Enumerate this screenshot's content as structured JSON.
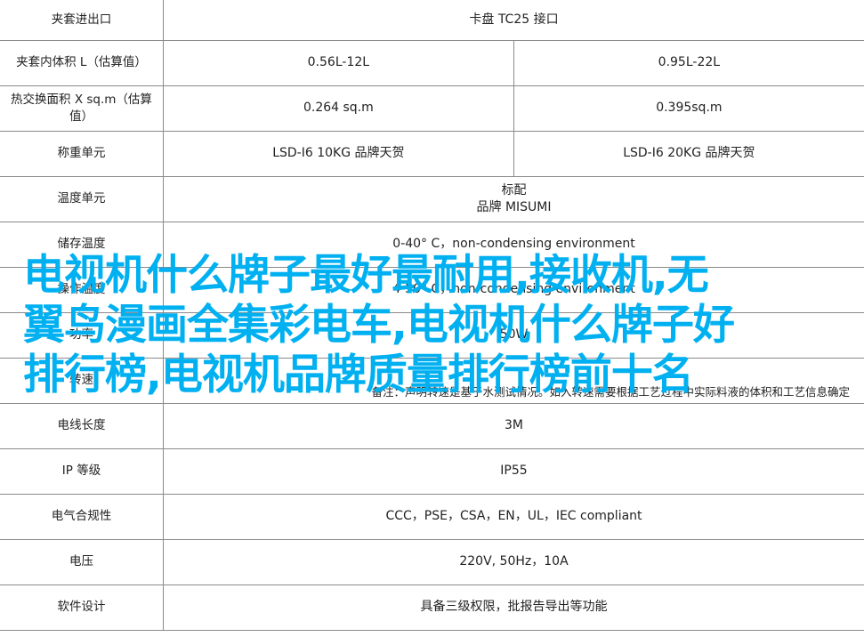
{
  "rows": [
    {
      "label": "夹套进出口",
      "span": false,
      "left": "",
      "right": "卡盘 TC25 接口"
    },
    {
      "label": "夹套内体积 L（估算值）",
      "span": false,
      "left": "0.56L-12L",
      "right": "0.95L-22L"
    },
    {
      "label": "热交换面积 X sq.m（估算值）",
      "span": false,
      "left": "0.264 sq.m",
      "right": "0.395sq.m"
    },
    {
      "label": "称重单元",
      "span": false,
      "left": "LSD-I6 10KG 品牌天贺",
      "right": "LSD-I6 20KG 品牌天贺"
    },
    {
      "label": "温度单元",
      "span": true,
      "line1": "标配",
      "line2": "品牌 MISUMI"
    },
    {
      "label": "储存温度",
      "span": true,
      "line1": "0-40° C，non-condensing environment",
      "line2": ""
    },
    {
      "label": "操作温度",
      "span": true,
      "line1": "4-50° C，non-condensing environment",
      "line2": ""
    },
    {
      "label": "功率",
      "span": true,
      "line1": "50W",
      "line2": ""
    },
    {
      "label": "转速",
      "span": true,
      "line1": "",
      "line2": "备注：声明转速是基于水测试情况。",
      "note": "如入转速需要根据工艺过程中实际料液的体积和工艺信息确定"
    },
    {
      "label": "电线长度",
      "span": true,
      "line1": "3M",
      "line2": ""
    },
    {
      "label": "IP 等级",
      "span": true,
      "line1": "IP55",
      "line2": ""
    },
    {
      "label": "电气合规性",
      "span": true,
      "line1": "CCC，PSE，CSA，EN，UL，IEC compliant",
      "line2": ""
    },
    {
      "label": "电压",
      "span": true,
      "line1": "220V, 50Hz，10A",
      "line2": ""
    },
    {
      "label": "软件设计",
      "span": true,
      "line1": "具备三级权限，批报告导出等功能",
      "line2": ""
    }
  ],
  "overlay": {
    "line1": "电视机什么牌子最好最耐用,接收机,无",
    "line2": "翼鸟漫画全集彩电车,电视机什么牌子好",
    "line3": "排行榜,电视机品牌质量排行榜前十名"
  },
  "colors": {
    "overlay": "#00b0f0",
    "border": "#8a8a8a"
  }
}
